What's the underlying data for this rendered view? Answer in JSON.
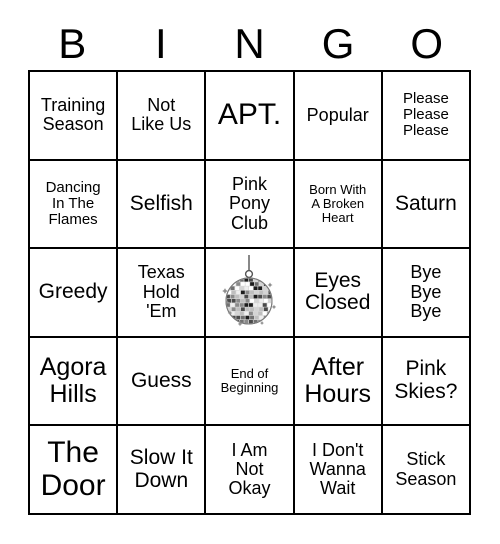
{
  "card": {
    "type": "bingo-card",
    "header_letters": [
      "B",
      "I",
      "N",
      "G",
      "O"
    ],
    "grid_size": "5x5",
    "free_space": {
      "position": "center",
      "icon": "disco-ball-icon",
      "label": ""
    },
    "colors": {
      "background": "#ffffff",
      "text": "#000000",
      "border": "#000000"
    },
    "rows": [
      [
        {
          "text": "Training\nSeason",
          "size": "md"
        },
        {
          "text": "Not\nLike Us",
          "size": "md"
        },
        {
          "text": "APT.",
          "size": "xxl"
        },
        {
          "text": "Popular",
          "size": "md"
        },
        {
          "text": "Please\nPlease\nPlease",
          "size": "sm"
        }
      ],
      [
        {
          "text": "Dancing\nIn The\nFlames",
          "size": "sm"
        },
        {
          "text": "Selfish",
          "size": "lg"
        },
        {
          "text": "Pink\nPony\nClub",
          "size": "md"
        },
        {
          "text": "Born With\nA Broken\nHeart",
          "size": "xs"
        },
        {
          "text": "Saturn",
          "size": "lg"
        }
      ],
      [
        {
          "text": "Greedy",
          "size": "lg"
        },
        {
          "text": "Texas\nHold\n'Em",
          "size": "md"
        },
        {
          "text": "",
          "size": "md",
          "icon": "disco-ball-icon"
        },
        {
          "text": "Eyes\nClosed",
          "size": "lg"
        },
        {
          "text": "Bye\nBye\nBye",
          "size": "md"
        }
      ],
      [
        {
          "text": "Agora\nHills",
          "size": "xl"
        },
        {
          "text": "Guess",
          "size": "lg"
        },
        {
          "text": "End of\nBeginning",
          "size": "xs"
        },
        {
          "text": "After\nHours",
          "size": "xl"
        },
        {
          "text": "Pink\nSkies?",
          "size": "lg"
        }
      ],
      [
        {
          "text": "The\nDoor",
          "size": "xxl"
        },
        {
          "text": "Slow It\nDown",
          "size": "lg"
        },
        {
          "text": "I Am\nNot\nOkay",
          "size": "md"
        },
        {
          "text": "I Don't\nWanna\nWait",
          "size": "md"
        },
        {
          "text": "Stick\nSeason",
          "size": "md"
        }
      ]
    ]
  }
}
